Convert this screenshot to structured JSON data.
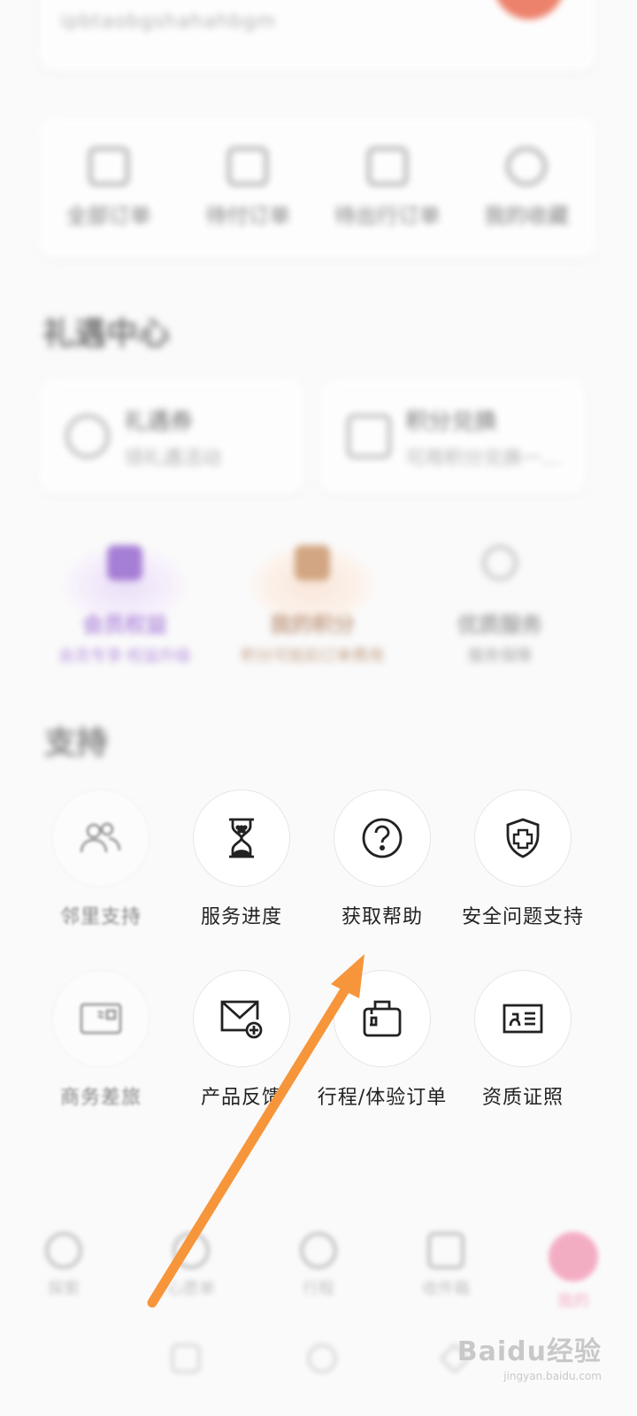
{
  "profile": {
    "text": "ipbtaobgshahahbgm",
    "avatar_color": "#e85a3c"
  },
  "orders": [
    {
      "label": "全部订单"
    },
    {
      "label": "待付订单"
    },
    {
      "label": "待出行订单"
    },
    {
      "label": "我的收藏"
    }
  ],
  "help_center": {
    "title": "礼遇中心",
    "cards": [
      {
        "title": "礼遇券",
        "subtitle": "领礼遇活动"
      },
      {
        "title": "积分兑换",
        "subtitle": "可用积分兑换一…"
      }
    ]
  },
  "features": [
    {
      "title": "会员权益",
      "subtitle": "会员专享·权益升级"
    },
    {
      "title": "我的积分",
      "subtitle": "积分可抵扣订单费用"
    },
    {
      "title": "优质服务",
      "subtitle": "服务保障"
    }
  ],
  "support": {
    "title": "支持",
    "items": [
      {
        "label": "邻里支持",
        "icon": "people-icon",
        "dim": true
      },
      {
        "label": "服务进度",
        "icon": "hourglass-icon",
        "dim": false
      },
      {
        "label": "获取帮助",
        "icon": "question-icon",
        "dim": false
      },
      {
        "label": "安全问题支持",
        "icon": "shield-plus-icon",
        "dim": false
      },
      {
        "label": "商务差旅",
        "icon": "card-icon",
        "dim": true
      },
      {
        "label": "产品反馈",
        "icon": "mail-plus-icon",
        "dim": false
      },
      {
        "label": "行程/体验订单",
        "icon": "luggage-icon",
        "dim": false
      },
      {
        "label": "资质证照",
        "icon": "id-card-icon",
        "dim": false
      }
    ]
  },
  "tabbar": [
    {
      "label": "探索",
      "active": false
    },
    {
      "label": "心愿单",
      "active": false
    },
    {
      "label": "行程",
      "active": false
    },
    {
      "label": "收件箱",
      "active": false
    },
    {
      "label": "我的",
      "active": true
    }
  ],
  "watermark": {
    "brand": "Baidu经验",
    "url": "jingyan.baidu.com"
  },
  "colors": {
    "arrow": "#f7953a",
    "accent": "#f07aa0"
  }
}
